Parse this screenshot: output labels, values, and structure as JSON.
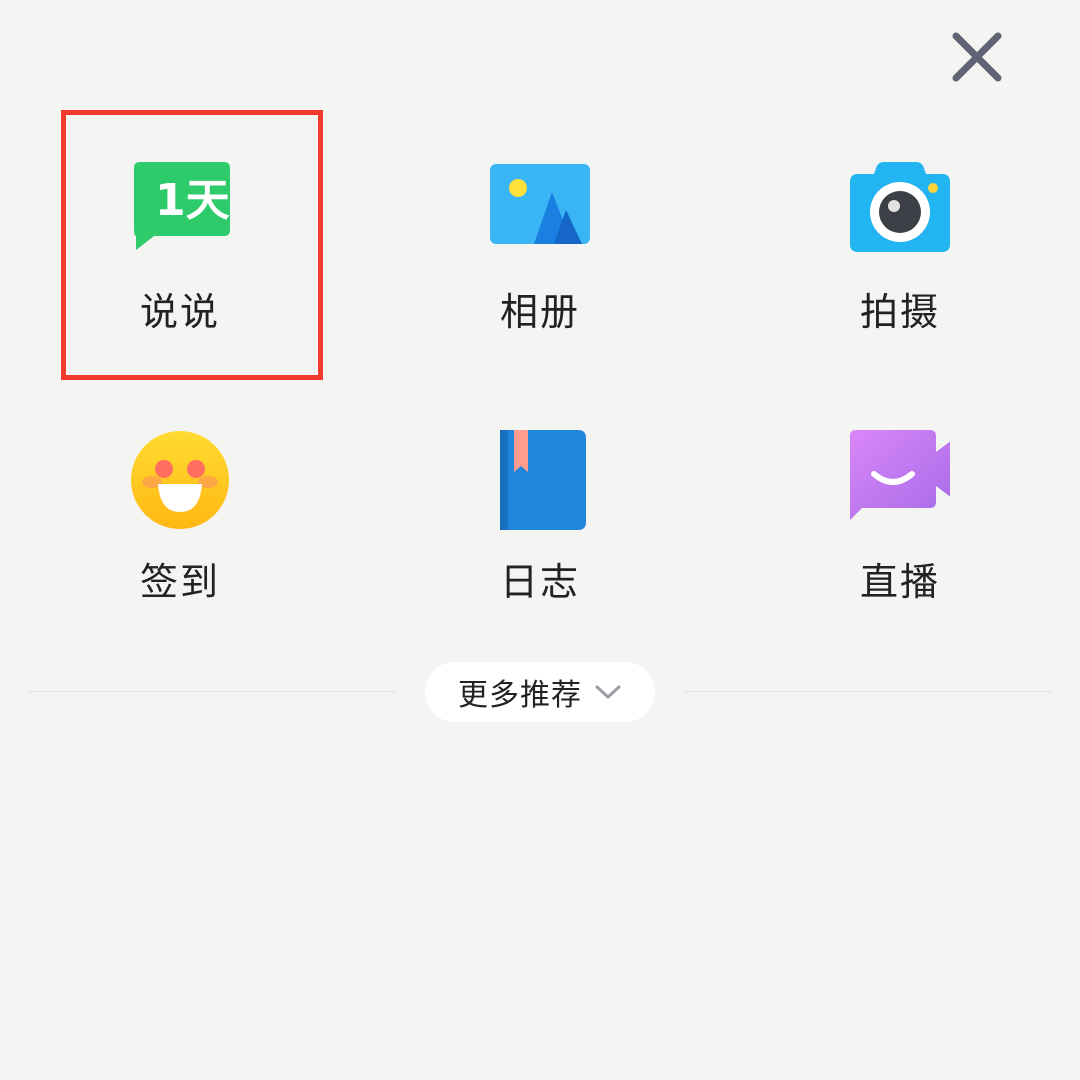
{
  "close": {
    "icon": "close-icon"
  },
  "menu": {
    "items": [
      {
        "label": "说说",
        "icon": "speech-bubble-1day-icon",
        "color": "#2ecb6a"
      },
      {
        "label": "相册",
        "icon": "photo-album-icon",
        "color": "#39b4f4"
      },
      {
        "label": "拍摄",
        "icon": "camera-icon",
        "color": "#22b5f1"
      },
      {
        "label": "签到",
        "icon": "smiley-face-icon",
        "color": "#ffc51a"
      },
      {
        "label": "日志",
        "icon": "journal-book-icon",
        "color": "#1f86db"
      },
      {
        "label": "直播",
        "icon": "video-camera-smile-icon",
        "color": "#c077f0"
      }
    ],
    "shuoshuo_badge": "1天"
  },
  "more": {
    "label": "更多推荐",
    "icon": "chevron-down-icon"
  },
  "highlight": {
    "color": "#f03a2e"
  }
}
